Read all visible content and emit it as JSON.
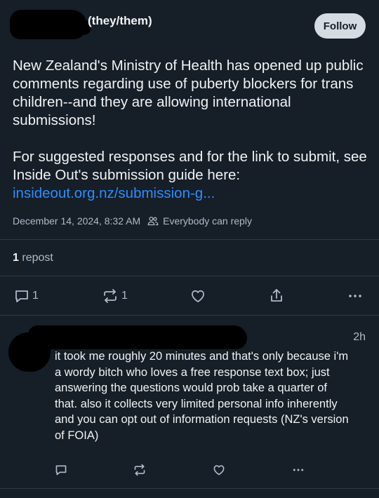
{
  "post": {
    "author_pronouns": "(they/them)",
    "follow_label": "Follow",
    "body_para1": "New Zealand's Ministry of Health has opened up public comments regarding use of puberty blockers for trans children--and they are allowing international submissions!",
    "body_para2": "For suggested responses and for the link to submit, see Inside Out's submission guide here:",
    "link_text": "insideout.org.nz/submission-g...",
    "date": "December 14, 2024, 8:32 AM",
    "reply_setting": "Everybody can reply",
    "repost_number": "1",
    "repost_label": "repost",
    "reply_count": "1",
    "repost_action_count": "1",
    "icons": [
      "reply-icon",
      "repost-icon",
      "like-icon",
      "share-icon",
      "more-icon",
      "people-icon"
    ]
  },
  "reply": {
    "time": "2h",
    "body": "it took me roughly 20 minutes and that's only because i'm a wordy bitch who loves a free response text box; just answering the questions would prob take a quarter of that. also it collects very limited personal info inherently and you can opt out of information requests (NZ's version of FOIA)",
    "icons": [
      "reply-icon",
      "repost-icon",
      "like-icon",
      "more-icon"
    ]
  },
  "colors": {
    "background": "#161e27",
    "text": "#f1f3f5",
    "muted": "#aebbc9",
    "link": "#2f8cff",
    "follow_button_bg": "#d4dbe2",
    "divider": "#2e3a47"
  }
}
